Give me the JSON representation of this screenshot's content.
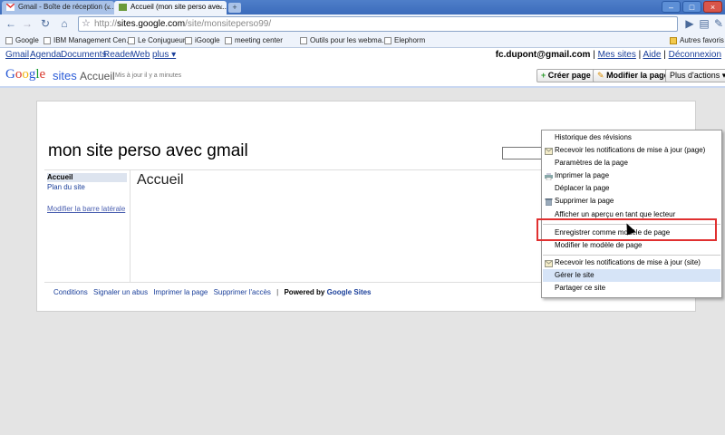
{
  "browser": {
    "tabs": [
      {
        "title": "Gmail - Boîte de réception (…"
      },
      {
        "title": "Accueil (mon site perso ave…"
      }
    ],
    "new_tab": "+",
    "url_prefix": "http://",
    "url_host": "sites.google.com",
    "url_path": "/site/monsiteperso99/",
    "bookmarks": [
      "Google",
      "IBM Management Cen…",
      "Le Conjugueur",
      "iGoogle",
      "meeting center",
      "Outils pour les webma…",
      "Elephorm"
    ],
    "bookmarks_other": "Autres favoris"
  },
  "gbar": {
    "links": [
      "Gmail",
      "Agenda",
      "Documents",
      "Reader",
      "Web",
      "plus ▾"
    ],
    "email": "fc.dupont@gmail.com",
    "my_sites": "Mes sites",
    "help": "Aide",
    "logout": "Déconnexion"
  },
  "sites_header": {
    "logo_google": [
      "G",
      "o",
      "o",
      "g",
      "l",
      "e"
    ],
    "logo_sites": "sites",
    "page_name": "Accueil",
    "updated": "Mis à jour il y a minutes",
    "create_page": "Créer page",
    "edit_page": "Modifier la page",
    "more_actions": "Plus d'actions ▾"
  },
  "site": {
    "title": "mon site perso avec gmail",
    "sidebar": [
      "Accueil",
      "Plan du site"
    ],
    "edit_sidebar": "Modifier la barre latérale",
    "heading": "Accueil",
    "footer": [
      "Conditions",
      "Signaler un abus",
      "Imprimer la page",
      "Supprimer l'accès"
    ],
    "powered_by": "Powered by",
    "powered_brand": "Google Sites"
  },
  "menu": {
    "items": [
      "Historique des révisions",
      "Recevoir les notifications de mise à jour (page)",
      "Paramètres de la page",
      "Imprimer la page",
      "Déplacer la page",
      "Supprimer la page",
      "Afficher un aperçu en tant que lecteur",
      "Enregistrer comme modèle de page",
      "Modifier le modèle de page",
      "Recevoir les notifications de mise à jour (site)",
      "Gérer le site",
      "Partager ce site"
    ]
  },
  "colors": {
    "link": "#1a3f9a",
    "highlight_box": "#e03030",
    "menu_hover": "#d6e4f7"
  }
}
